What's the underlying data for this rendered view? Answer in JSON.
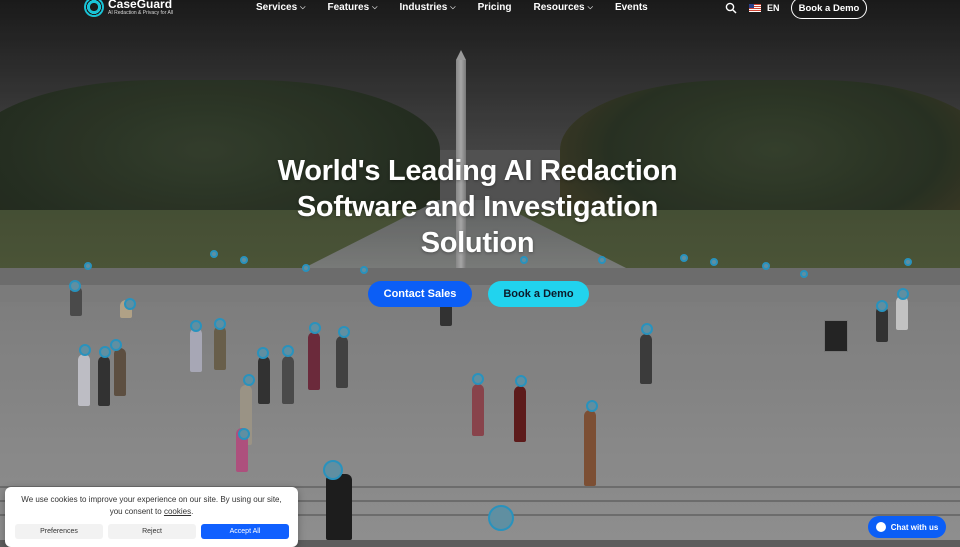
{
  "header": {
    "logo_name": "CaseGuard",
    "logo_tagline": "AI Redaction & Privacy for All",
    "nav": [
      {
        "label": "Services",
        "has_dropdown": true
      },
      {
        "label": "Features",
        "has_dropdown": true
      },
      {
        "label": "Industries",
        "has_dropdown": true
      },
      {
        "label": "Pricing",
        "has_dropdown": false
      },
      {
        "label": "Resources",
        "has_dropdown": true
      },
      {
        "label": "Events",
        "has_dropdown": false
      }
    ],
    "chevron": "⌵",
    "language": "EN",
    "demo_button": "Book a Demo"
  },
  "hero": {
    "title_line1": "World's Leading AI Redaction",
    "title_line2": "Software and Investigation",
    "title_line3": "Solution",
    "contact_button": "Contact Sales",
    "demo_button": "Book a Demo"
  },
  "cookie_banner": {
    "text_before_link": "We use cookies to improve your experience on our site. By using our site, you consent to ",
    "link_text": "cookies",
    "text_after_link": ".",
    "preferences_button": "Preferences",
    "reject_button": "Reject",
    "accept_button": "Accept All"
  },
  "chat": {
    "label": "Chat with us"
  },
  "colors": {
    "primary_blue": "#0b5ef6",
    "accent_cyan": "#21d3ee",
    "face_redaction": "#2fa7d8"
  },
  "icons": {
    "search": "search-icon",
    "flag": "us-flag-icon",
    "chat": "chat-bubble-icon"
  }
}
